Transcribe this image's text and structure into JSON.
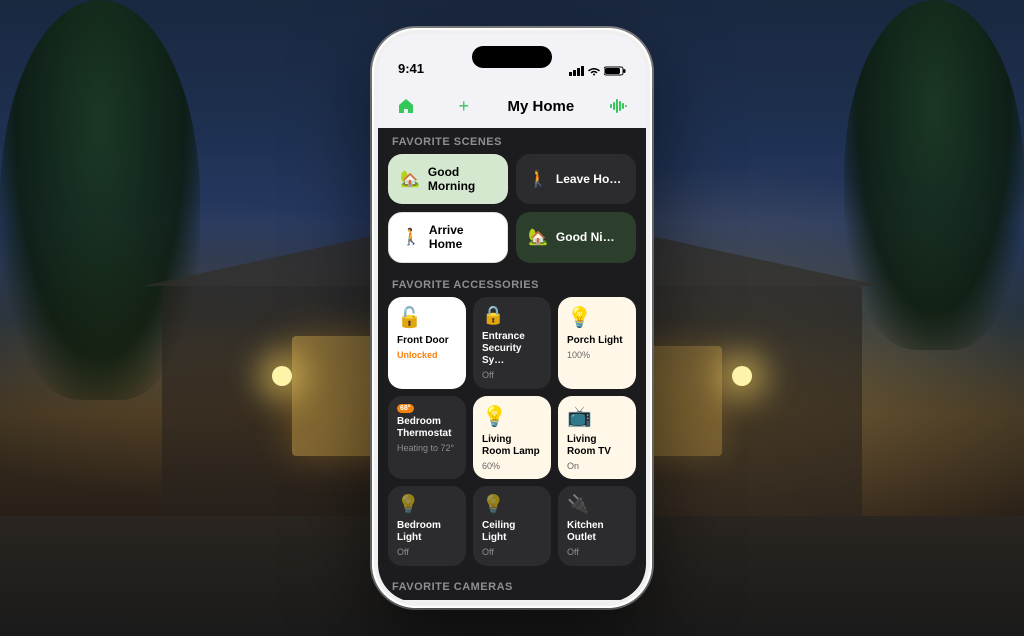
{
  "background": {
    "description": "Modern house at night with outdoor lighting"
  },
  "phone": {
    "status_bar": {
      "time": "9:41",
      "signal_label": "signal",
      "wifi_label": "wifi",
      "battery_label": "battery"
    },
    "nav": {
      "home_icon": "🏠",
      "add_icon": "+",
      "title": "My Home",
      "siri_icon": "𝌊"
    },
    "favorite_scenes": {
      "label": "Favorite Scenes",
      "scenes": [
        {
          "id": "good-morning",
          "icon": "🏡",
          "name": "Good Morning",
          "active": true
        },
        {
          "id": "leave-home",
          "icon": "🚶",
          "name": "Leave Ho…",
          "active": false
        },
        {
          "id": "arrive-home",
          "icon": "🚶",
          "name": "Arrive Home",
          "active": true,
          "style": "active-orange"
        },
        {
          "id": "good-night",
          "icon": "🏡",
          "name": "Good Ni…",
          "active": false,
          "style": "dark-active"
        }
      ]
    },
    "favorite_accessories": {
      "label": "Favorite Accessories",
      "accessories": [
        {
          "id": "front-door",
          "icon": "🔓",
          "name": "Front Door",
          "status": "Unlocked",
          "active": true
        },
        {
          "id": "entrance-security",
          "icon": "🔒",
          "name": "Entrance Security Sy…",
          "status": "Off",
          "active": false
        },
        {
          "id": "porch-light",
          "icon": "💡",
          "name": "Porch Light",
          "status": "100%",
          "active": false,
          "light": true
        },
        {
          "id": "bedroom-thermostat",
          "icon": "🌡️",
          "name": "Bedroom Thermostat",
          "status": "Heating to 72°",
          "active": false
        },
        {
          "id": "living-room-lamp",
          "icon": "💡",
          "name": "Living Room Lamp",
          "status": "60%",
          "active": false,
          "light": true
        },
        {
          "id": "living-room-tv",
          "icon": "📺",
          "name": "Living Room TV",
          "status": "On",
          "active": false,
          "light": true
        },
        {
          "id": "bedroom-light",
          "icon": "💡",
          "name": "Bedroom Light",
          "status": "Off",
          "active": false
        },
        {
          "id": "ceiling-light",
          "icon": "💡",
          "name": "Ceiling Light",
          "status": "Off",
          "active": false
        },
        {
          "id": "kitchen-outlet",
          "icon": "🔌",
          "name": "Kitchen Outlet",
          "status": "Off",
          "active": false
        }
      ]
    },
    "favorite_cameras": {
      "label": "Favorite Cameras"
    }
  }
}
